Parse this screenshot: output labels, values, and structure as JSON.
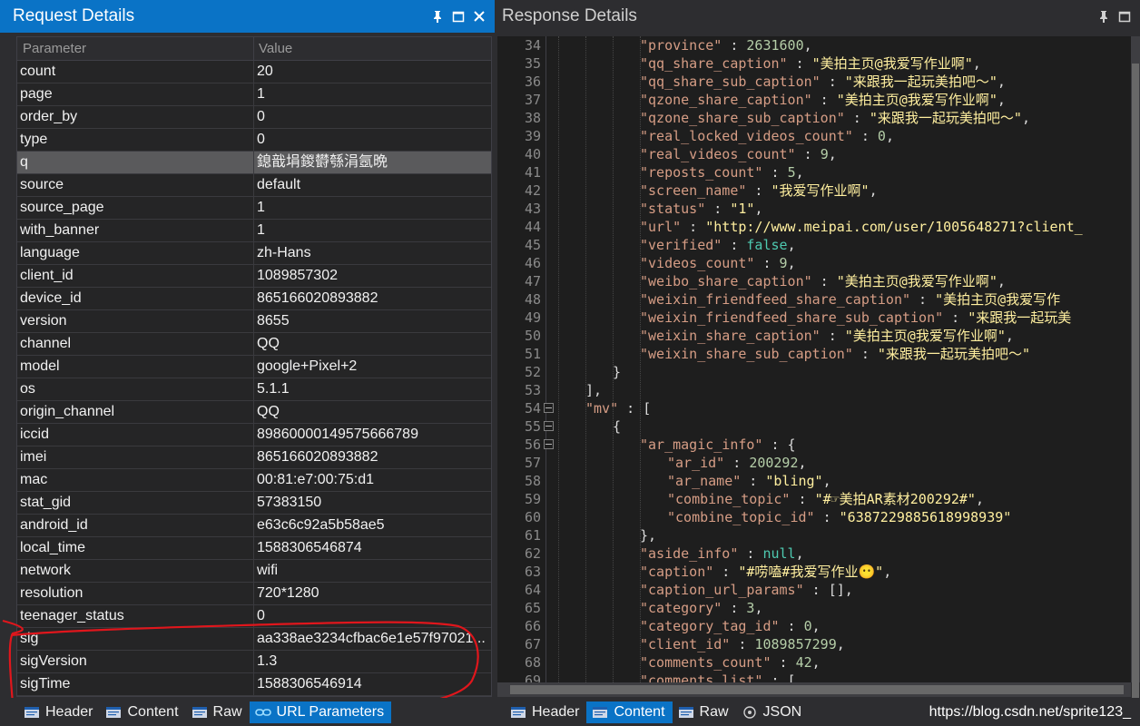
{
  "left_panel": {
    "title": "Request Details",
    "columns": {
      "parameter": "Parameter",
      "value": "Value"
    },
    "rows": [
      {
        "k": "count",
        "v": "20"
      },
      {
        "k": "page",
        "v": "1"
      },
      {
        "k": "order_by",
        "v": "0"
      },
      {
        "k": "type",
        "v": "0"
      },
      {
        "k": "q",
        "v": "鎴戠埍鍐欎綔涓氬晩",
        "selected": true
      },
      {
        "k": "source",
        "v": "default"
      },
      {
        "k": "source_page",
        "v": "1"
      },
      {
        "k": "with_banner",
        "v": "1"
      },
      {
        "k": "language",
        "v": "zh-Hans"
      },
      {
        "k": "client_id",
        "v": "1089857302"
      },
      {
        "k": "device_id",
        "v": "865166020893882"
      },
      {
        "k": "version",
        "v": "8655"
      },
      {
        "k": "channel",
        "v": "QQ"
      },
      {
        "k": "model",
        "v": "google+Pixel+2"
      },
      {
        "k": "os",
        "v": "5.1.1"
      },
      {
        "k": "origin_channel",
        "v": "QQ"
      },
      {
        "k": "iccid",
        "v": "89860000149575666789"
      },
      {
        "k": "imei",
        "v": "865166020893882"
      },
      {
        "k": "mac",
        "v": "00:81:e7:00:75:d1"
      },
      {
        "k": "stat_gid",
        "v": "57383150"
      },
      {
        "k": "android_id",
        "v": "e63c6c92a5b58ae5"
      },
      {
        "k": "local_time",
        "v": "1588306546874"
      },
      {
        "k": "network",
        "v": "wifi"
      },
      {
        "k": "resolution",
        "v": "720*1280"
      },
      {
        "k": "teenager_status",
        "v": "0"
      },
      {
        "k": "sig",
        "v": "aa338ae3234cfbac6e1e57f97021..."
      },
      {
        "k": "sigVersion",
        "v": "1.3"
      },
      {
        "k": "sigTime",
        "v": "1588306546914"
      }
    ],
    "tabs": [
      {
        "label": "Header",
        "icon": "header-tab-icon",
        "active": false
      },
      {
        "label": "Content",
        "icon": "content-tab-icon",
        "active": false
      },
      {
        "label": "Raw",
        "icon": "raw-tab-icon",
        "active": false
      },
      {
        "label": "URL Parameters",
        "icon": "link-icon",
        "active": true
      }
    ]
  },
  "right_panel": {
    "title": "Response Details",
    "tabs": [
      {
        "label": "Header",
        "icon": "header-tab-icon",
        "active": false
      },
      {
        "label": "Content",
        "icon": "content-tab-icon",
        "active": true
      },
      {
        "label": "Raw",
        "icon": "raw-tab-icon",
        "active": false
      },
      {
        "label": "JSON",
        "icon": "json-tab-icon",
        "active": false
      }
    ],
    "watermark": "https://blog.csdn.net/sprite123_",
    "code_lines": [
      {
        "n": "34",
        "ind": 4,
        "seg": [
          [
            "k",
            "\"province\""
          ],
          [
            "p",
            " : "
          ],
          [
            "n",
            "2631600"
          ],
          [
            "p",
            ","
          ]
        ]
      },
      {
        "n": "35",
        "ind": 4,
        "seg": [
          [
            "k",
            "\"qq_share_caption\""
          ],
          [
            "p",
            " : "
          ],
          [
            "s",
            "\"美拍主页@我爱写作业啊\""
          ],
          [
            "p",
            ","
          ]
        ]
      },
      {
        "n": "36",
        "ind": 4,
        "seg": [
          [
            "k",
            "\"qq_share_sub_caption\""
          ],
          [
            "p",
            " : "
          ],
          [
            "s",
            "\"来跟我一起玩美拍吧～\""
          ],
          [
            "p",
            ","
          ]
        ]
      },
      {
        "n": "37",
        "ind": 4,
        "seg": [
          [
            "k",
            "\"qzone_share_caption\""
          ],
          [
            "p",
            " : "
          ],
          [
            "s",
            "\"美拍主页@我爱写作业啊\""
          ],
          [
            "p",
            ","
          ]
        ]
      },
      {
        "n": "38",
        "ind": 4,
        "seg": [
          [
            "k",
            "\"qzone_share_sub_caption\""
          ],
          [
            "p",
            " : "
          ],
          [
            "s",
            "\"来跟我一起玩美拍吧～\""
          ],
          [
            "p",
            ","
          ]
        ]
      },
      {
        "n": "39",
        "ind": 4,
        "seg": [
          [
            "k",
            "\"real_locked_videos_count\""
          ],
          [
            "p",
            " : "
          ],
          [
            "n",
            "0"
          ],
          [
            "p",
            ","
          ]
        ]
      },
      {
        "n": "40",
        "ind": 4,
        "seg": [
          [
            "k",
            "\"real_videos_count\""
          ],
          [
            "p",
            " : "
          ],
          [
            "n",
            "9"
          ],
          [
            "p",
            ","
          ]
        ]
      },
      {
        "n": "41",
        "ind": 4,
        "seg": [
          [
            "k",
            "\"reposts_count\""
          ],
          [
            "p",
            " : "
          ],
          [
            "n",
            "5"
          ],
          [
            "p",
            ","
          ]
        ]
      },
      {
        "n": "42",
        "ind": 4,
        "seg": [
          [
            "k",
            "\"screen_name\""
          ],
          [
            "p",
            " : "
          ],
          [
            "s",
            "\"我爱写作业啊\""
          ],
          [
            "p",
            ","
          ]
        ]
      },
      {
        "n": "43",
        "ind": 4,
        "seg": [
          [
            "k",
            "\"status\""
          ],
          [
            "p",
            " : "
          ],
          [
            "s",
            "\"1\""
          ],
          [
            "p",
            ","
          ]
        ]
      },
      {
        "n": "44",
        "ind": 4,
        "seg": [
          [
            "k",
            "\"url\""
          ],
          [
            "p",
            " : "
          ],
          [
            "s",
            "\"http://www.meipai.com/user/1005648271?client_"
          ]
        ]
      },
      {
        "n": "45",
        "ind": 4,
        "seg": [
          [
            "k",
            "\"verified\""
          ],
          [
            "p",
            " : "
          ],
          [
            "l",
            "false"
          ],
          [
            "p",
            ","
          ]
        ]
      },
      {
        "n": "46",
        "ind": 4,
        "seg": [
          [
            "k",
            "\"videos_count\""
          ],
          [
            "p",
            " : "
          ],
          [
            "n",
            "9"
          ],
          [
            "p",
            ","
          ]
        ]
      },
      {
        "n": "47",
        "ind": 4,
        "seg": [
          [
            "k",
            "\"weibo_share_caption\""
          ],
          [
            "p",
            " : "
          ],
          [
            "s",
            "\"美拍主页@我爱写作业啊\""
          ],
          [
            "p",
            ","
          ]
        ]
      },
      {
        "n": "48",
        "ind": 4,
        "seg": [
          [
            "k",
            "\"weixin_friendfeed_share_caption\""
          ],
          [
            "p",
            " : "
          ],
          [
            "s",
            "\"美拍主页@我爱写作"
          ]
        ]
      },
      {
        "n": "49",
        "ind": 4,
        "seg": [
          [
            "k",
            "\"weixin_friendfeed_share_sub_caption\""
          ],
          [
            "p",
            " : "
          ],
          [
            "s",
            "\"来跟我一起玩美"
          ]
        ]
      },
      {
        "n": "50",
        "ind": 4,
        "seg": [
          [
            "k",
            "\"weixin_share_caption\""
          ],
          [
            "p",
            " : "
          ],
          [
            "s",
            "\"美拍主页@我爱写作业啊\""
          ],
          [
            "p",
            ","
          ]
        ]
      },
      {
        "n": "51",
        "ind": 4,
        "seg": [
          [
            "k",
            "\"weixin_share_sub_caption\""
          ],
          [
            "p",
            " : "
          ],
          [
            "s",
            "\"来跟我一起玩美拍吧～\""
          ]
        ]
      },
      {
        "n": "52",
        "ind": 3,
        "seg": [
          [
            "p",
            "}"
          ]
        ]
      },
      {
        "n": "53",
        "ind": 2,
        "seg": [
          [
            "p",
            "],"
          ]
        ]
      },
      {
        "n": "54",
        "ind": 2,
        "fold": true,
        "seg": [
          [
            "k",
            "\"mv\""
          ],
          [
            "p",
            " : ["
          ]
        ]
      },
      {
        "n": "55",
        "ind": 3,
        "fold": true,
        "seg": [
          [
            "p",
            "{"
          ]
        ]
      },
      {
        "n": "56",
        "ind": 4,
        "fold": true,
        "seg": [
          [
            "k",
            "\"ar_magic_info\""
          ],
          [
            "p",
            " : {"
          ]
        ]
      },
      {
        "n": "57",
        "ind": 5,
        "seg": [
          [
            "k",
            "\"ar_id\""
          ],
          [
            "p",
            " : "
          ],
          [
            "n",
            "200292"
          ],
          [
            "p",
            ","
          ]
        ]
      },
      {
        "n": "58",
        "ind": 5,
        "seg": [
          [
            "k",
            "\"ar_name\""
          ],
          [
            "p",
            " : "
          ],
          [
            "s",
            "\"bling\""
          ],
          [
            "p",
            ","
          ]
        ]
      },
      {
        "n": "59",
        "ind": 5,
        "seg": [
          [
            "k",
            "\"combine_topic\""
          ],
          [
            "p",
            " : "
          ],
          [
            "s",
            "\"#☞美拍AR素材200292#\""
          ],
          [
            "p",
            ","
          ]
        ]
      },
      {
        "n": "60",
        "ind": 5,
        "seg": [
          [
            "k",
            "\"combine_topic_id\""
          ],
          [
            "p",
            " : "
          ],
          [
            "s",
            "\"6387229885618998939\""
          ]
        ]
      },
      {
        "n": "61",
        "ind": 4,
        "seg": [
          [
            "p",
            "},"
          ]
        ]
      },
      {
        "n": "62",
        "ind": 4,
        "seg": [
          [
            "k",
            "\"aside_info\""
          ],
          [
            "p",
            " : "
          ],
          [
            "l",
            "null"
          ],
          [
            "p",
            ","
          ]
        ]
      },
      {
        "n": "63",
        "ind": 4,
        "seg": [
          [
            "k",
            "\"caption\""
          ],
          [
            "p",
            " : "
          ],
          [
            "s",
            "\"#唠嗑#我爱写作业😶\""
          ],
          [
            "p",
            ","
          ]
        ]
      },
      {
        "n": "64",
        "ind": 4,
        "seg": [
          [
            "k",
            "\"caption_url_params\""
          ],
          [
            "p",
            " : [],"
          ]
        ]
      },
      {
        "n": "65",
        "ind": 4,
        "seg": [
          [
            "k",
            "\"category\""
          ],
          [
            "p",
            " : "
          ],
          [
            "n",
            "3"
          ],
          [
            "p",
            ","
          ]
        ]
      },
      {
        "n": "66",
        "ind": 4,
        "seg": [
          [
            "k",
            "\"category_tag_id\""
          ],
          [
            "p",
            " : "
          ],
          [
            "n",
            "0"
          ],
          [
            "p",
            ","
          ]
        ]
      },
      {
        "n": "67",
        "ind": 4,
        "seg": [
          [
            "k",
            "\"client_id\""
          ],
          [
            "p",
            " : "
          ],
          [
            "n",
            "1089857299"
          ],
          [
            "p",
            ","
          ]
        ]
      },
      {
        "n": "68",
        "ind": 4,
        "seg": [
          [
            "k",
            "\"comments_count\""
          ],
          [
            "p",
            " : "
          ],
          [
            "n",
            "42"
          ],
          [
            "p",
            ","
          ]
        ]
      },
      {
        "n": "69",
        "ind": 4,
        "seg": [
          [
            "k",
            "\"comments_list\""
          ],
          [
            "p",
            " : ["
          ]
        ]
      }
    ]
  }
}
